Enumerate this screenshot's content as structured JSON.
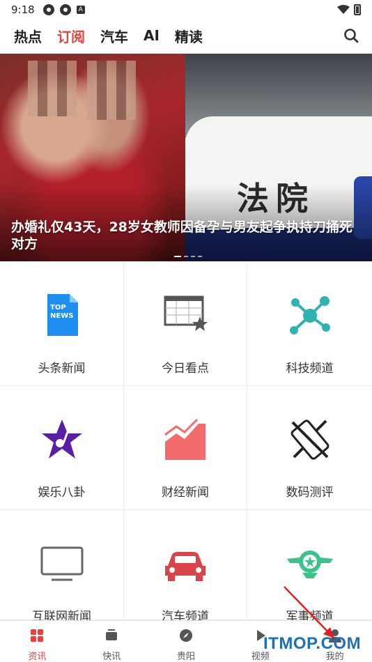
{
  "status_bar": {
    "time": "9:18",
    "a_badge": "A"
  },
  "top_nav": {
    "tabs": [
      {
        "label": "热点",
        "active": false
      },
      {
        "label": "订阅",
        "active": true
      },
      {
        "label": "汽车",
        "active": false
      },
      {
        "label": "AI",
        "active": false
      },
      {
        "label": "精读",
        "active": false
      }
    ],
    "search_icon": "search-icon",
    "active_color": "#e9413b"
  },
  "banner": {
    "headline": "办婚礼仅43天，28岁女教师因备孕与男友起争执持刀捅死对方",
    "car_text": "法院"
  },
  "grid": [
    {
      "label": "头条新闻",
      "icon": "top-news-icon",
      "icon_text": "TOP\nNEWS"
    },
    {
      "label": "今日看点",
      "icon": "calendar-star-icon"
    },
    {
      "label": "科技频道",
      "icon": "molecule-icon"
    },
    {
      "label": "娱乐八卦",
      "icon": "music-star-icon"
    },
    {
      "label": "财经新闻",
      "icon": "trend-chart-icon"
    },
    {
      "label": "数码测评",
      "icon": "phone-tools-icon"
    },
    {
      "label": "互联网新闻",
      "icon": "monitor-icon"
    },
    {
      "label": "汽车频道",
      "icon": "car-icon"
    },
    {
      "label": "军事频道",
      "icon": "military-badge-icon"
    }
  ],
  "bottom_nav": [
    {
      "label": "资讯",
      "icon": "grid-icon",
      "active": true
    },
    {
      "label": "快讯",
      "icon": "tv-icon",
      "active": false
    },
    {
      "label": "贵阳",
      "icon": "compass-icon",
      "active": false
    },
    {
      "label": "视频",
      "icon": "play-icon",
      "active": false
    },
    {
      "label": "我的",
      "icon": "user-icon",
      "active": false
    }
  ],
  "watermark": "ITMOP.COM"
}
